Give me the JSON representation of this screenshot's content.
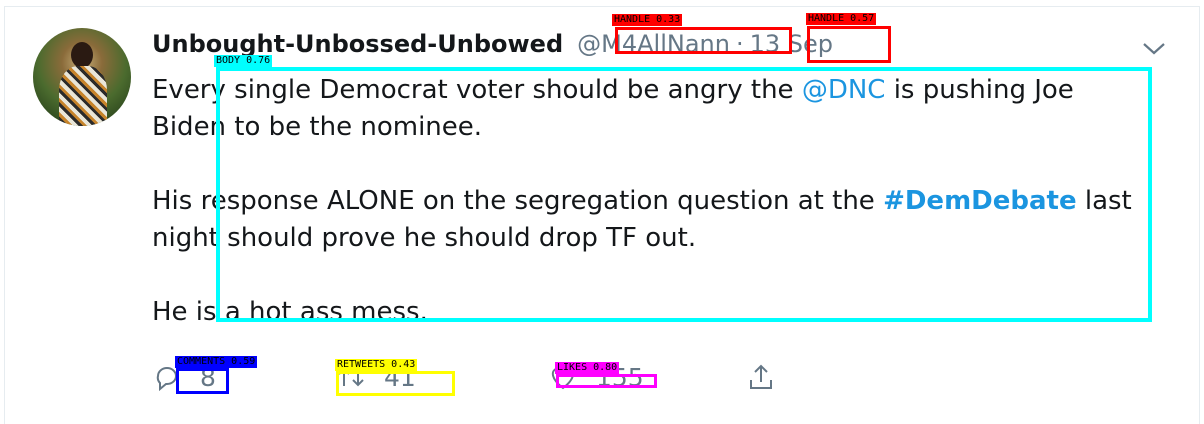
{
  "tweet": {
    "display_name": "Unbought-Unbossed-Unbowed",
    "handle": "@M4AllNann",
    "separator": "·",
    "date": "13 Sep",
    "lines": {
      "l1_pre": "Every single Democrat voter should be angry the ",
      "l1_link": "@DNC",
      "l1_post": " is pushing Joe Biden to be the nominee.",
      "l2_pre": "His response ALONE on the segregation question at the ",
      "l2_tag": "#DemDebate",
      "l2_post": " last night should prove he should drop TF out.",
      "l3": "He is a hot ass mess."
    },
    "counts": {
      "comments": "8",
      "retweets": "41",
      "likes": "155"
    }
  },
  "annotations": {
    "handle_a": "HANDLE 0.33",
    "handle_b": "HANDLE 0.57",
    "body": "BODY 0.76",
    "comments": "COMMENTS 0.59",
    "retweets": "RETWEETS 0.43",
    "likes": "LIKES 0.80"
  },
  "colors": {
    "handle_box": "#ff0000",
    "body_box": "#00ffff",
    "comments_box": "#0000ff",
    "retweets_box": "#ffff00",
    "likes_box": "#ff00ff",
    "link": "#1b95e0",
    "muted": "#657786"
  },
  "icons": [
    "reply-icon",
    "retweet-icon",
    "like-icon",
    "share-icon",
    "chevron-down-icon"
  ]
}
